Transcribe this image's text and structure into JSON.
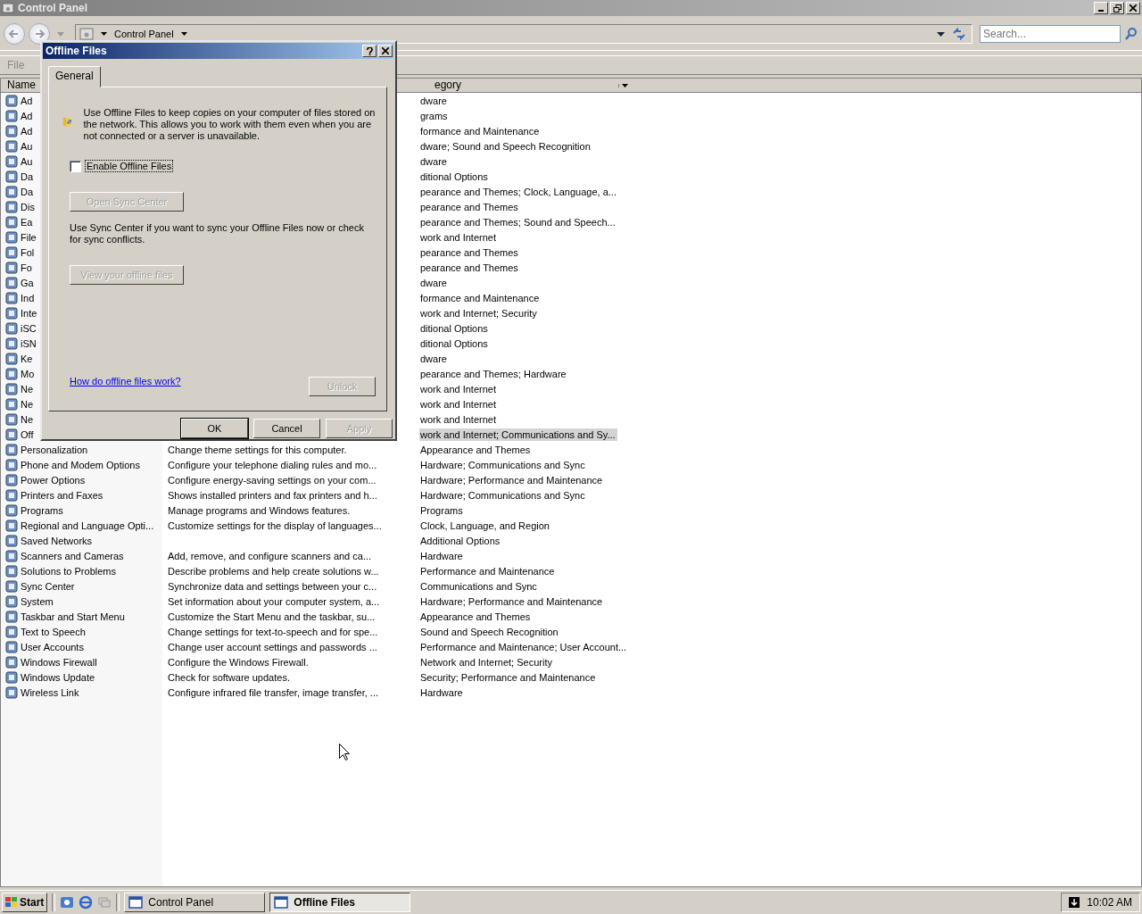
{
  "window": {
    "title": "Control Panel"
  },
  "address_bar": {
    "path": "Control Panel",
    "search_placeholder": "Search..."
  },
  "menu": [
    "File"
  ],
  "list": {
    "columns": [
      "Name",
      "egory"
    ],
    "rows": [
      {
        "kind": "covered",
        "name": "Ad",
        "category": "dware",
        "selected": false
      },
      {
        "kind": "covered",
        "name": "Ad",
        "category": "grams",
        "selected": false
      },
      {
        "kind": "covered",
        "name": "Ad",
        "category": "formance and Maintenance",
        "selected": false
      },
      {
        "kind": "covered",
        "name": "Au",
        "category": "dware; Sound and Speech Recognition",
        "selected": false
      },
      {
        "kind": "covered",
        "name": "Au",
        "category": "dware",
        "selected": false
      },
      {
        "kind": "covered",
        "name": "Da",
        "category": "ditional Options",
        "selected": false
      },
      {
        "kind": "covered",
        "name": "Da",
        "category": "pearance and Themes; Clock, Language, a...",
        "selected": false
      },
      {
        "kind": "covered",
        "name": "Dis",
        "category": "pearance and Themes",
        "selected": false
      },
      {
        "kind": "covered",
        "name": "Ea",
        "category": "pearance and Themes; Sound and Speech...",
        "selected": false
      },
      {
        "kind": "covered",
        "name": "File",
        "category": "work and Internet",
        "selected": false
      },
      {
        "kind": "covered",
        "name": "Fol",
        "category": "pearance and Themes",
        "selected": false
      },
      {
        "kind": "covered",
        "name": "Fo",
        "category": "pearance and Themes",
        "selected": false
      },
      {
        "kind": "covered",
        "name": "Ga",
        "category": "dware",
        "selected": false
      },
      {
        "kind": "covered",
        "name": "Ind",
        "category": "formance and Maintenance",
        "selected": false
      },
      {
        "kind": "covered",
        "name": "Inte",
        "category": "work and Internet; Security",
        "selected": false
      },
      {
        "kind": "covered",
        "name": "iSC",
        "category": "ditional Options",
        "selected": false
      },
      {
        "kind": "covered",
        "name": "iSN",
        "category": "ditional Options",
        "selected": false
      },
      {
        "kind": "covered",
        "name": "Ke",
        "category": "dware",
        "selected": false
      },
      {
        "kind": "covered",
        "name": "Mo",
        "category": "pearance and Themes; Hardware",
        "selected": false
      },
      {
        "kind": "covered",
        "name": "Ne",
        "category": "work and Internet",
        "selected": false
      },
      {
        "kind": "covered",
        "name": "Ne",
        "category": "work and Internet",
        "selected": false
      },
      {
        "kind": "covered",
        "name": "Ne",
        "category": "work and Internet",
        "selected": false
      },
      {
        "kind": "covered",
        "name": "Off",
        "category": "work and Internet; Communications and Sy...",
        "selected": true
      },
      {
        "kind": "full",
        "name": "Personalization",
        "description": "Change theme settings for this computer.",
        "category": "Appearance and Themes",
        "selected": false
      },
      {
        "kind": "full",
        "name": "Phone and Modem Options",
        "description": "Configure your telephone dialing rules and mo...",
        "category": "Hardware; Communications and Sync",
        "selected": false
      },
      {
        "kind": "full",
        "name": "Power Options",
        "description": "Configure energy-saving settings on your com...",
        "category": "Hardware; Performance and Maintenance",
        "selected": false
      },
      {
        "kind": "full",
        "name": "Printers and Faxes",
        "description": "Shows installed printers and fax printers and h...",
        "category": "Hardware; Communications and Sync",
        "selected": false
      },
      {
        "kind": "full",
        "name": "Programs",
        "description": "Manage programs and Windows features.",
        "category": "Programs",
        "selected": false
      },
      {
        "kind": "full",
        "name": "Regional and Language Opti...",
        "description": "Customize settings for the display of languages...",
        "category": "Clock, Language, and Region",
        "selected": false
      },
      {
        "kind": "full",
        "name": "Saved Networks",
        "category": "Additional Options",
        "selected": false
      },
      {
        "kind": "full",
        "name": "Scanners and Cameras",
        "description": "Add, remove, and configure scanners and ca...",
        "category": "Hardware",
        "selected": false
      },
      {
        "kind": "full",
        "name": "Solutions to Problems",
        "description": "Describe problems and help create solutions w...",
        "category": "Performance and Maintenance",
        "selected": false
      },
      {
        "kind": "full",
        "name": "Sync Center",
        "description": "Synchronize data and settings between your c...",
        "category": "Communications and Sync",
        "selected": false
      },
      {
        "kind": "full",
        "name": "System",
        "description": "Set information about your computer system, a...",
        "category": "Hardware; Performance and Maintenance",
        "selected": false
      },
      {
        "kind": "full",
        "name": "Taskbar and Start Menu",
        "description": "Customize the Start Menu and the taskbar, su...",
        "category": "Appearance and Themes",
        "selected": false
      },
      {
        "kind": "full",
        "name": "Text to Speech",
        "description": "Change settings for text-to-speech and for spe...",
        "category": "Sound and Speech Recognition",
        "selected": false
      },
      {
        "kind": "full",
        "name": "User Accounts",
        "description": "Change user account settings and passwords ...",
        "category": "Performance and Maintenance; User Account...",
        "selected": false
      },
      {
        "kind": "full",
        "name": "Windows Firewall",
        "description": "Configure the Windows Firewall.",
        "category": "Network and Internet; Security",
        "selected": false
      },
      {
        "kind": "full",
        "name": "Windows Update",
        "description": "Check for software updates.",
        "category": "Security; Performance and Maintenance",
        "selected": false
      },
      {
        "kind": "full",
        "name": "Wireless Link",
        "description": "Configure infrared file transfer, image transfer, ...",
        "category": "Hardware",
        "selected": false
      }
    ]
  },
  "dialog": {
    "title": "Offline Files",
    "tabs": [
      {
        "label": "General",
        "selected": true
      }
    ],
    "intro": "Use Offline Files to keep copies on your computer of files stored on the network.  This allows you to work with them even when you are not connected or a server is unavailable.",
    "checkbox": {
      "label": "Enable Offline Files",
      "checked": false
    },
    "open_sync_button": {
      "label": "Open Sync Center",
      "disabled": true
    },
    "sync_text": "Use Sync Center if you want to sync your Offline Files now or check for sync conflicts.",
    "view_button": {
      "label": "View your offline files",
      "disabled": true
    },
    "help_link": "How do offline files work?",
    "unlock_button": {
      "label": "Unlock",
      "disabled": true
    },
    "buttons": [
      {
        "label": "OK",
        "disabled": false
      },
      {
        "label": "Cancel",
        "disabled": false
      },
      {
        "label": "Apply",
        "disabled": true
      }
    ]
  },
  "taskbar": {
    "start": "Start",
    "tasks": [
      {
        "label": "Control Panel",
        "selected": false
      },
      {
        "label": "Offline Files",
        "selected": true
      }
    ],
    "clock": "10:02 AM"
  }
}
